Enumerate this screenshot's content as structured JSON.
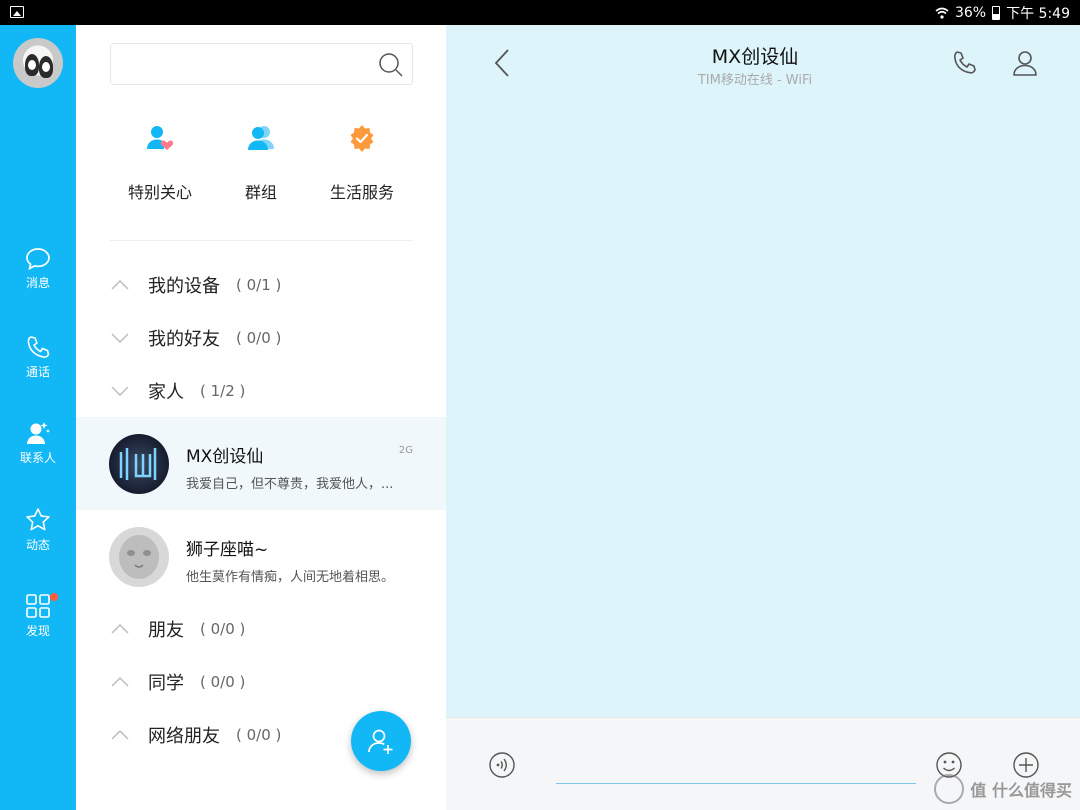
{
  "status_bar": {
    "battery": "36%",
    "time": "下午 5:49"
  },
  "rail": {
    "items": [
      {
        "label": "消息"
      },
      {
        "label": "通话"
      },
      {
        "label": "联系人"
      },
      {
        "label": "动态"
      },
      {
        "label": "发现"
      }
    ]
  },
  "contacts": {
    "search": {
      "placeholder": ""
    },
    "shortcuts": [
      {
        "label": "特别关心",
        "icon": "special-care-icon"
      },
      {
        "label": "群组",
        "icon": "group-icon"
      },
      {
        "label": "生活服务",
        "icon": "life-service-icon"
      }
    ],
    "groups": [
      {
        "name": "我的设备",
        "count": "( 0/1 )"
      },
      {
        "name": "我的好友",
        "count": "( 0/0 )"
      },
      {
        "name": "家人",
        "count": "( 1/2 )"
      },
      {
        "name": "朋友",
        "count": "( 0/0 )"
      },
      {
        "name": "同学",
        "count": "( 0/0 )"
      },
      {
        "name": "网络朋友",
        "count": "( 0/0 )"
      }
    ],
    "people": [
      {
        "name": "MX创设仙",
        "message": "我爱自己，但不尊贵，我爱他人，...",
        "tag": "2G"
      },
      {
        "name": "狮子座喵~",
        "message": "他生莫作有情痴，人间无地着相思。",
        "tag": ""
      }
    ]
  },
  "chat": {
    "title": "MX创设仙",
    "subtitle": "TIM移动在线 - WiFi"
  },
  "watermark": {
    "text": "值 什么值得买"
  },
  "colors": {
    "accent": "#12b7f5",
    "chat_bg": "#ddf4fb",
    "badge": "#ff5a3c",
    "orange": "#ff9a3c"
  }
}
